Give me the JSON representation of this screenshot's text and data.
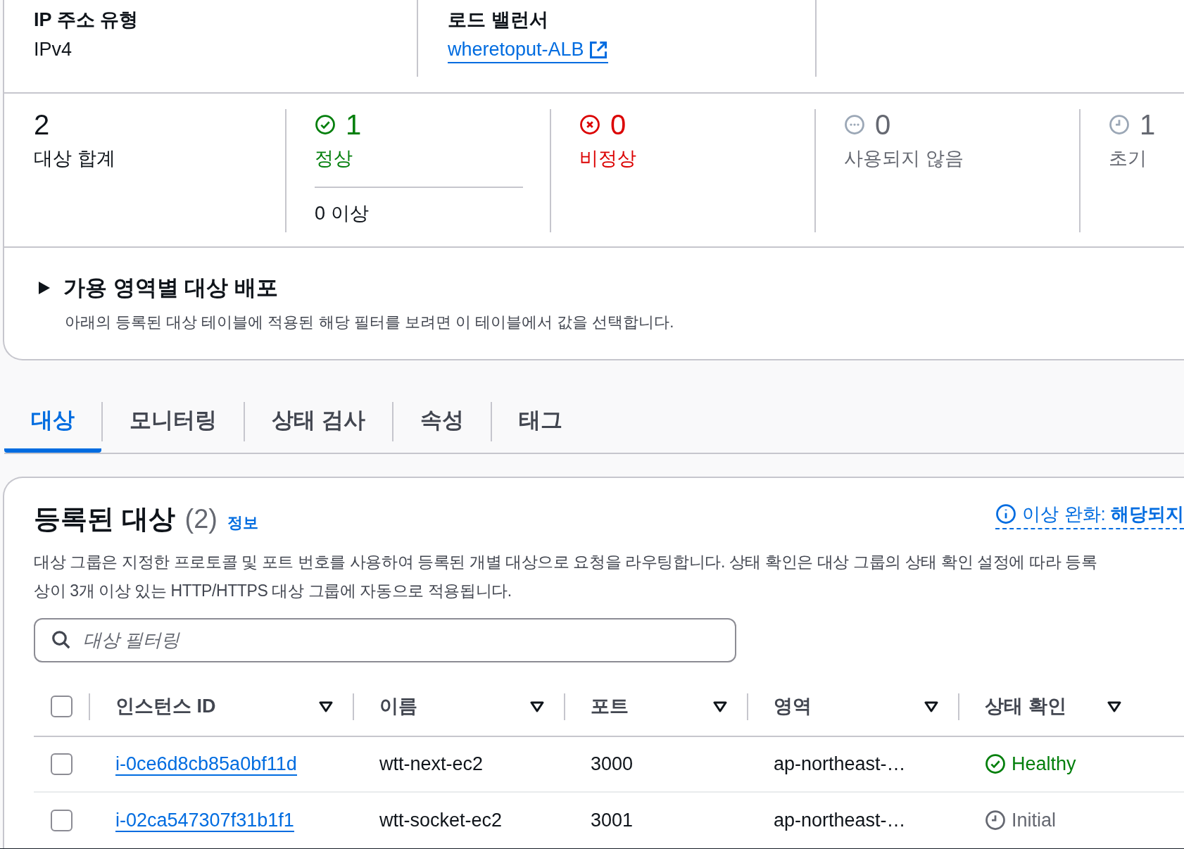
{
  "details": [
    {
      "label": "IP 주소 유형",
      "value": "IPv4",
      "kind": "text"
    },
    {
      "label": "로드 밸런서",
      "value": "wheretoput-ALB",
      "kind": "link"
    }
  ],
  "stats": [
    {
      "kind": "total",
      "count": "2",
      "label": "대상 합계"
    },
    {
      "kind": "healthy",
      "count": "1",
      "label": "정상",
      "sub": "0 이상"
    },
    {
      "kind": "unhealthy",
      "count": "0",
      "label": "비정상"
    },
    {
      "kind": "unused",
      "count": "0",
      "label": "사용되지 않음"
    },
    {
      "kind": "initial",
      "count": "1",
      "label": "초기"
    }
  ],
  "distribution": {
    "title": "가용 영역별 대상 배포",
    "description": "아래의 등록된 대상 테이블에 적용된 해당 필터를 보려면 이 테이블에서 값을 선택합니다.",
    "expanded": false
  },
  "tabs": [
    {
      "label": "대상",
      "selected": true
    },
    {
      "label": "모니터링",
      "selected": false
    },
    {
      "label": "상태 검사",
      "selected": false
    },
    {
      "label": "속성",
      "selected": false
    },
    {
      "label": "태그",
      "selected": false
    }
  ],
  "targets": {
    "title": "등록된 대상",
    "count": "(2)",
    "info": "정보",
    "mitigation": "이상 완화: **해당되지**",
    "description_lines": [
      "대상 그룹은 지정한 프로토콜 및 포트 번호를 사용하여 등록된 개별 대상으로 요청을 라우팅합니다. 상태 확인은 대상 그룹의 상태 확인 설정에 따라 등록",
      "상이 3개 이상 있는 HTTP/HTTPS 대상 그룹에 자동으로 적용됩니다."
    ],
    "filter": {
      "placeholder": "대상 필터링"
    },
    "columns": [
      "인스턴스 ID",
      "이름",
      "포트",
      "영역",
      "상태 확인"
    ],
    "select_all": {
      "checked": false
    },
    "rows": [
      {
        "checked": false,
        "instance_id": "i-0ce6d8cb85a0bf11d",
        "name": "wtt-next-ec2",
        "port": "3000",
        "zone": "ap-northeast-…",
        "health": "Healthy",
        "kind": "healthy"
      },
      {
        "checked": false,
        "instance_id": "i-02ca547307f31b1f1",
        "name": "wtt-socket-ec2",
        "port": "3001",
        "zone": "ap-northeast-…",
        "health": "Initial",
        "kind": "initial"
      }
    ]
  }
}
